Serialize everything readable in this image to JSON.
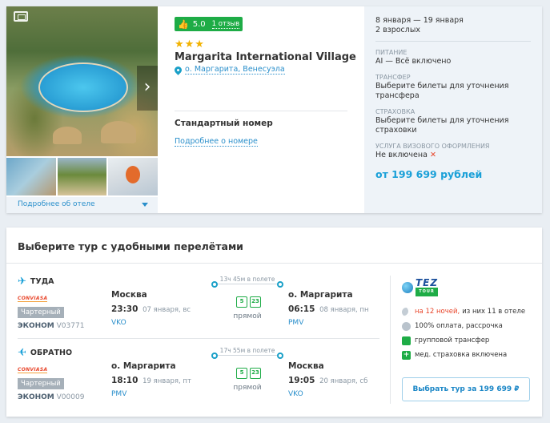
{
  "hotel": {
    "rating_score": "5.0",
    "reviews_label": "1 отзыв",
    "stars": "★★★",
    "name": "Margarita International Village",
    "location": "о. Маргарита, Венесуэла",
    "more_label": "Подробнее об отеле",
    "room_type": "Стандартный номер",
    "room_link": "Подробнее о номере"
  },
  "summary": {
    "dates": "8 января — 19 января",
    "guests": "2 взрослых",
    "meal_label": "Питание",
    "meal_value": "AI — Всё включено",
    "transfer_label": "Трансфер",
    "transfer_value": "Выберите билеты для уточнения трансфера",
    "insurance_label": "Страховка",
    "insurance_value": "Выберите билеты для уточнения страховки",
    "visa_label": "Услуга визового оформления",
    "visa_value": "Не включена",
    "visa_mark": "✕",
    "price": "от 199 699 рублей"
  },
  "tours": {
    "title": "Выберите тур с удобными перелётами",
    "legs": [
      {
        "direction": "ТУДА",
        "airline": "CONVIASA",
        "charter": "Чартерный",
        "class": "ЭКОНОМ",
        "flight": "V03771",
        "from_city": "Москва",
        "from_time": "23:30",
        "from_date": "07 января, вс",
        "from_airport": "VKO",
        "duration": "13ч 45м в полете",
        "direct": "прямой",
        "bag_kg": "5",
        "bag2_kg": "23",
        "to_city": "о. Маргарита",
        "to_time": "06:15",
        "to_date": "08 января, пн",
        "to_airport": "PMV"
      },
      {
        "direction": "ОБРАТНО",
        "airline": "CONVIASA",
        "charter": "Чартерный",
        "class": "ЭКОНОМ",
        "flight": "V00009",
        "from_city": "о. Маргарита",
        "from_time": "18:10",
        "from_date": "19 января, пт",
        "from_airport": "PMV",
        "duration": "17ч 55м в полете",
        "direct": "прямой",
        "bag_kg": "5",
        "bag2_kg": "23",
        "to_city": "Москва",
        "to_time": "19:05",
        "to_date": "20 января, сб",
        "to_airport": "VKO"
      }
    ],
    "operator": {
      "name": "TEZ",
      "tag": "TOUR",
      "nights_highlight": "на 12 ночей,",
      "nights_rest": "из них 11 в отеле",
      "payment": "100% оплата, рассрочка",
      "transfer": "групповой трансфер",
      "insurance": "мед. страховка включена"
    },
    "book_button": "Выбрать тур за 199 699 ₽"
  },
  "colors": {
    "accent": "#1aa0d8",
    "green": "#1eac46",
    "red": "#e8462b",
    "star": "#f2b200"
  }
}
